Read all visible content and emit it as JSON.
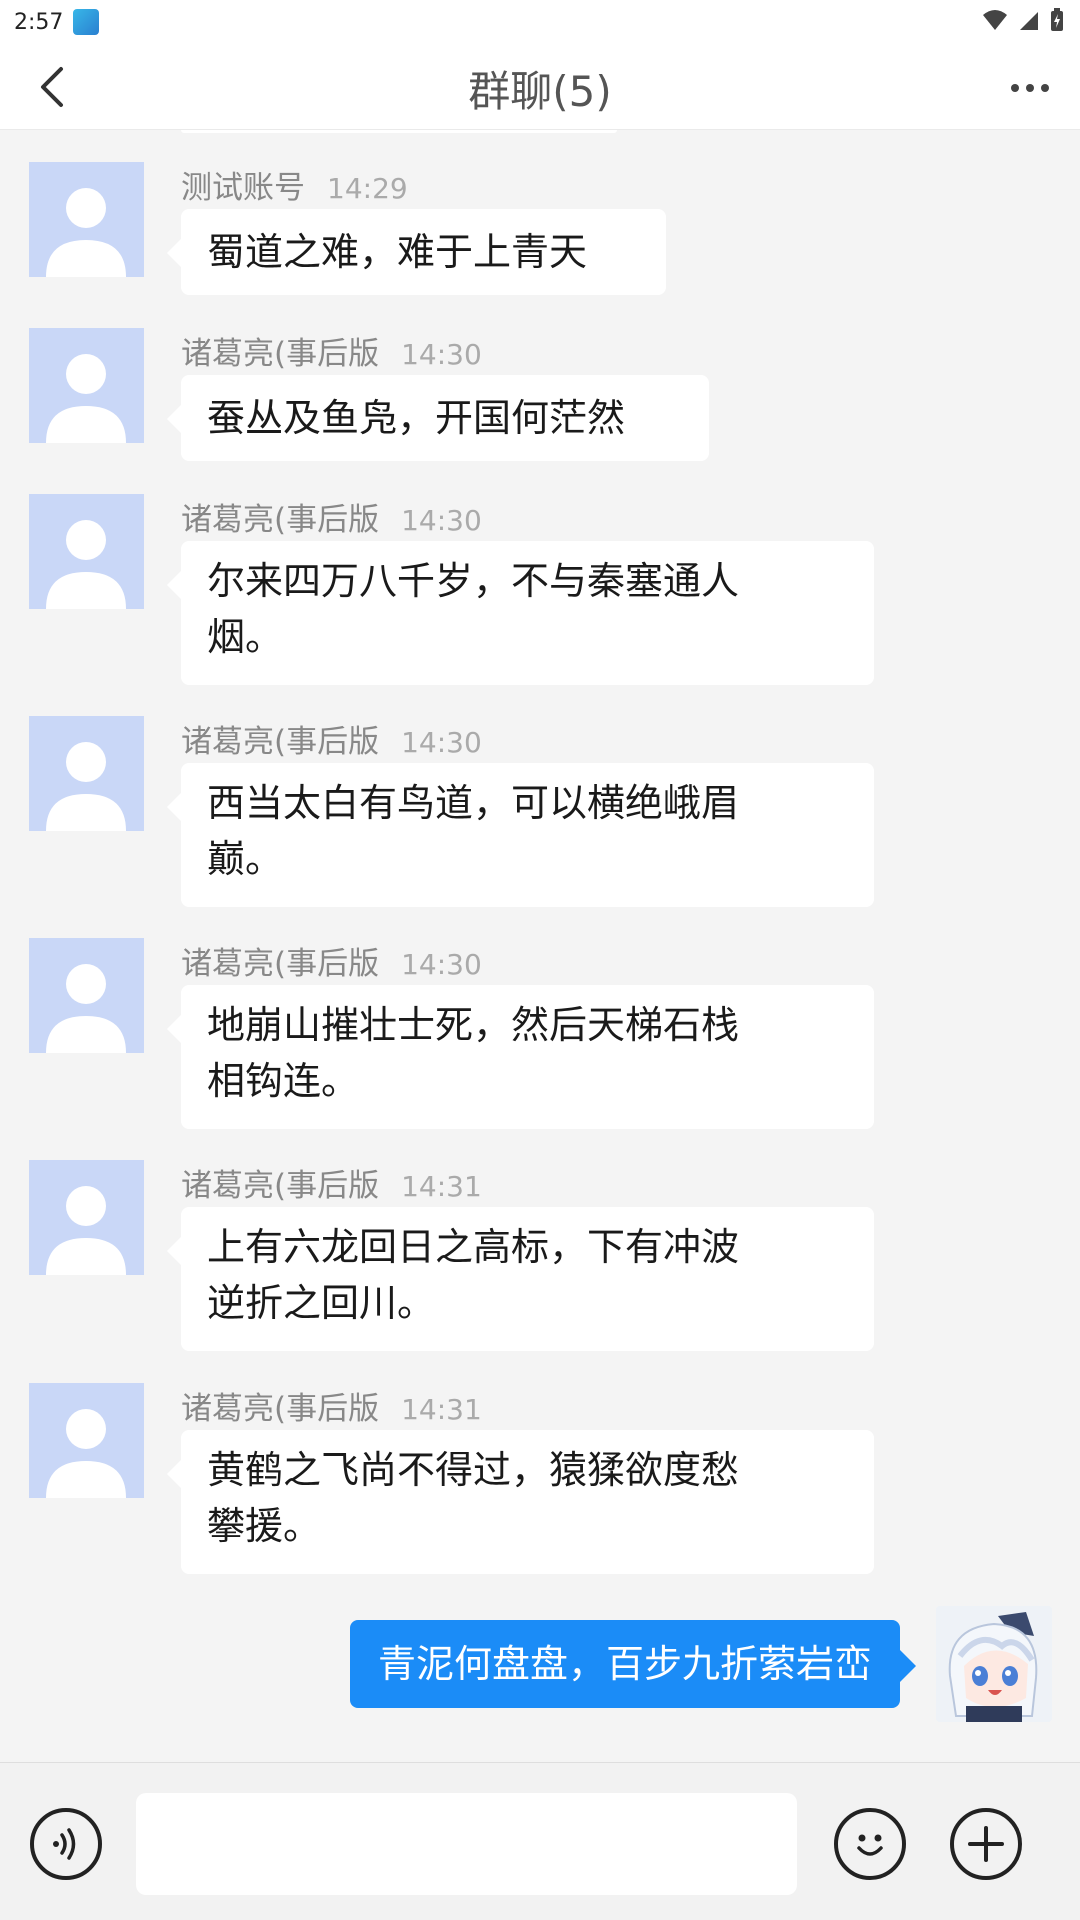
{
  "status_bar": {
    "time": "2:57"
  },
  "header": {
    "title": "群聊(5)"
  },
  "messages": [
    {
      "name": "测试账号",
      "time": "14:29",
      "text": "蜀道之难，难于上青天"
    },
    {
      "name": "诸葛亮(事后版",
      "time": "14:30",
      "text": "蚕丛及鱼凫，开国何茫然"
    },
    {
      "name": "诸葛亮(事后版",
      "time": "14:30",
      "text_line1": "尔来四万八千岁，不与秦塞通人",
      "text_line2": "烟。"
    },
    {
      "name": "诸葛亮(事后版",
      "time": "14:30",
      "text_line1": "西当太白有鸟道，可以横绝峨眉",
      "text_line2": "巅。"
    },
    {
      "name": "诸葛亮(事后版",
      "time": "14:30",
      "text_line1": "地崩山摧壮士死，然后天梯石栈",
      "text_line2": "相钩连。"
    },
    {
      "name": "诸葛亮(事后版",
      "time": "14:31",
      "text_line1": "上有六龙回日之高标，下有冲波",
      "text_line2": "逆折之回川。"
    },
    {
      "name": "诸葛亮(事后版",
      "time": "14:31",
      "text_line1": "黄鹤之飞尚不得过，猿猱欲度愁",
      "text_line2": "攀援。"
    }
  ],
  "self_message": {
    "text": "青泥何盘盘，百步九折萦岩峦"
  },
  "input_bar": {
    "value": ""
  },
  "icons": {
    "back": "chevron-left-icon",
    "more": "more-horizontal-icon",
    "voice": "voice-icon",
    "emoji": "emoji-icon",
    "add": "plus-circle-icon"
  },
  "colors": {
    "accent": "#1b8cf7",
    "avatar_placeholder": "#c9d7f7",
    "background": "#f4f4f4"
  }
}
